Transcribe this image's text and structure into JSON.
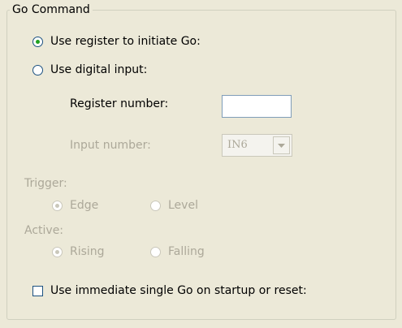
{
  "group": {
    "title": "Go Command"
  },
  "go_source": {
    "options": [
      {
        "label": "Use register to initiate Go:",
        "checked": true
      },
      {
        "label": "Use digital input:",
        "checked": false
      }
    ]
  },
  "register_number": {
    "label": "Register number:",
    "value": ""
  },
  "input_number": {
    "label": "Input number:",
    "value": "IN6",
    "arrow_icon": "chevron-down-icon"
  },
  "trigger": {
    "label": "Trigger:",
    "options": [
      {
        "label": "Edge",
        "checked": true
      },
      {
        "label": "Level",
        "checked": false
      }
    ]
  },
  "active": {
    "label": "Active:",
    "options": [
      {
        "label": "Rising",
        "checked": true
      },
      {
        "label": "Falling",
        "checked": false
      }
    ]
  },
  "immediate_go": {
    "label": "Use immediate single Go on startup or reset:",
    "checked": false
  },
  "colors": {
    "panel_bg": "#ece9d8",
    "disabled_text": "#aca899",
    "radio_dot": "#21a121",
    "control_border": "#1c5180"
  }
}
